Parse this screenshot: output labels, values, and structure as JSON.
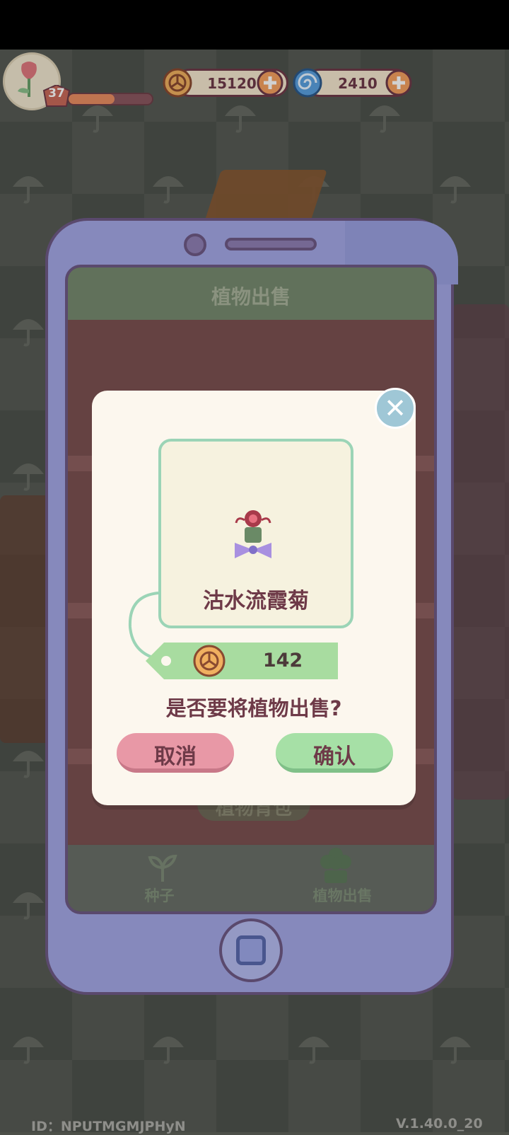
{
  "hud": {
    "level": "37",
    "xp_progress": 0.55,
    "coins": "15120",
    "gems": "2410"
  },
  "phone": {
    "title": "植物出售",
    "backpack_button": "植物背包",
    "tabs": [
      {
        "label": "种子",
        "icon": "sprout-icon"
      },
      {
        "label": "植物出售",
        "icon": "flower-icon"
      }
    ]
  },
  "dialog": {
    "plant_name": "沽水流霞菊",
    "price": "142",
    "question": "是否要将植物出售?",
    "cancel_label": "取消",
    "confirm_label": "确认"
  },
  "footer": {
    "id": "ID：NPUTMGMJPHyN",
    "version": "V.1.40.0_20"
  },
  "colors": {
    "accent": "#6e3a48",
    "confirm": "#a6e0a6",
    "cancel": "#e898a6",
    "phone_frame": "#a4a8e6"
  }
}
